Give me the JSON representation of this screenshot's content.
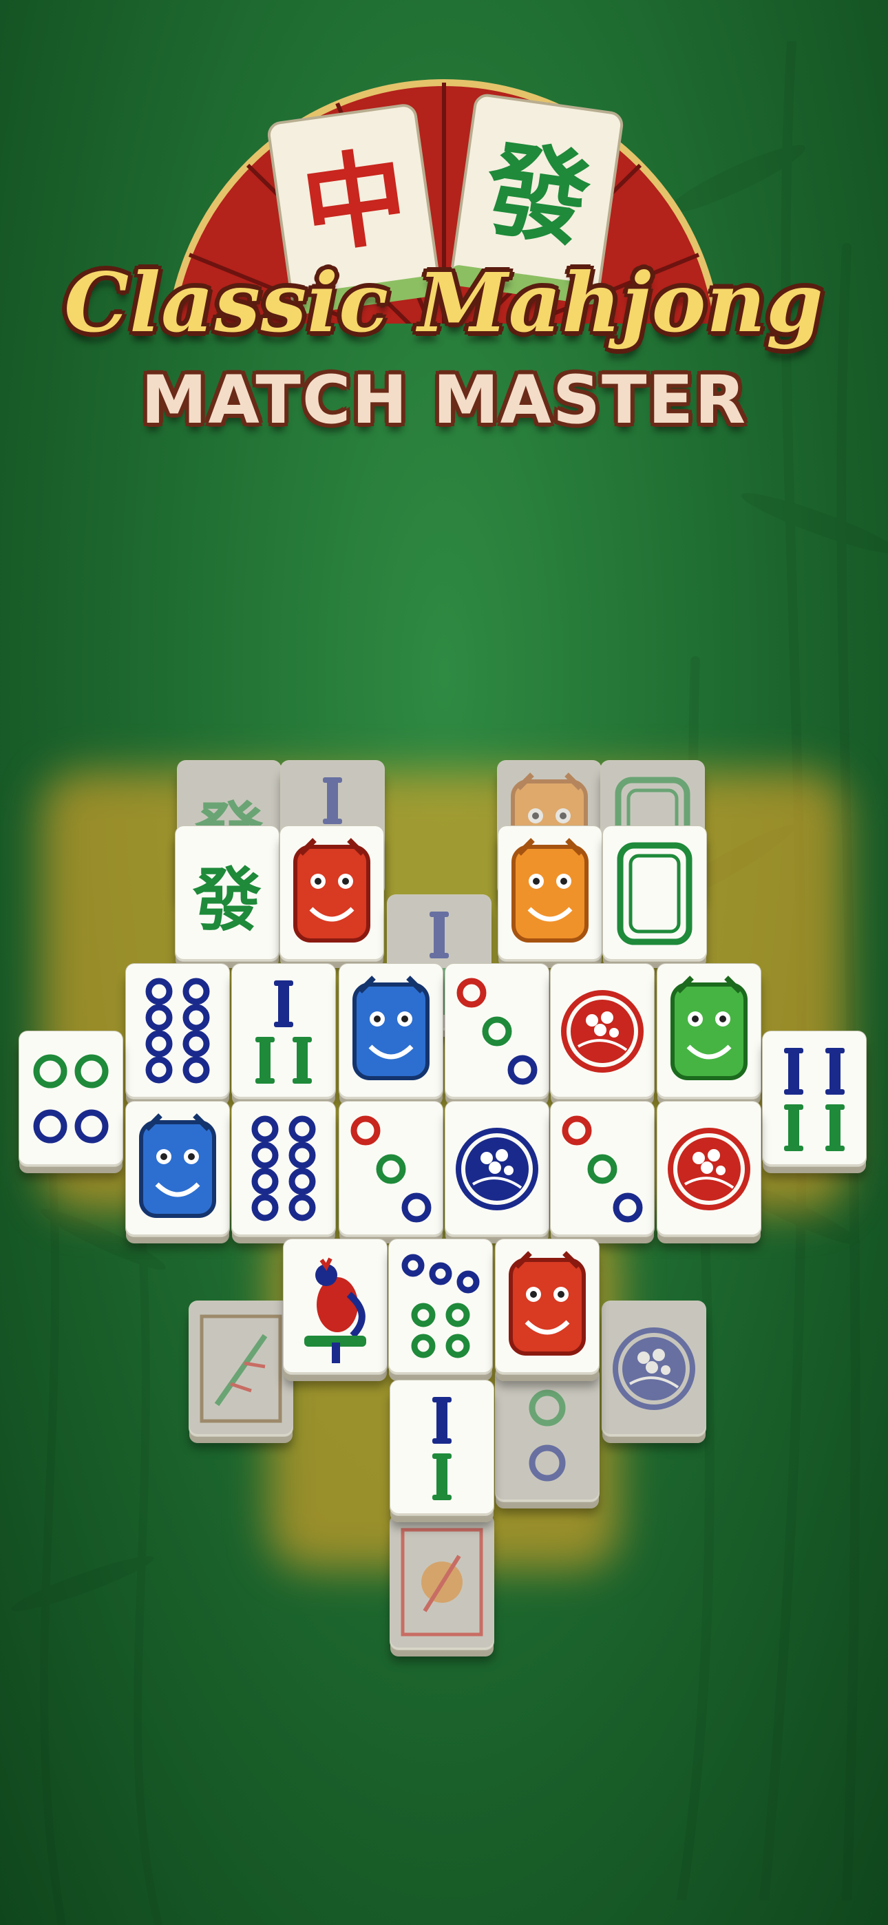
{
  "title": {
    "line1": "Classic Mahjong",
    "line2": "MATCH MASTER",
    "logo_tiles": [
      "中",
      "發"
    ]
  },
  "colors": {
    "background": "#1f6c31",
    "tile_face": "#fbfbf5",
    "mahjong_red": "#c8261e",
    "mahjong_green": "#1e8a3a",
    "mahjong_blue": "#1a2a8c",
    "glow": "#ffaf28",
    "title_gold": "#f6d76a"
  },
  "tiles": [
    {
      "id": "t01",
      "icon": "green-dragon-char-icon",
      "text": "發",
      "dim": true
    },
    {
      "id": "t02",
      "icon": "bamboo-three-icon",
      "dim": true
    },
    {
      "id": "t03",
      "icon": "dragon-orange-icon",
      "dim": true
    },
    {
      "id": "t04",
      "icon": "white-dragon-frame-icon",
      "dim": true
    },
    {
      "id": "t05",
      "icon": "green-dragon-char-icon",
      "text": "發"
    },
    {
      "id": "t06",
      "icon": "dragon-red-icon"
    },
    {
      "id": "t07",
      "icon": "dragon-orange-icon"
    },
    {
      "id": "t08",
      "icon": "white-dragon-frame-icon"
    },
    {
      "id": "t09",
      "icon": "bamboo-two-icon",
      "dim": true
    },
    {
      "id": "t10",
      "icon": "circle-eight-icon"
    },
    {
      "id": "t11",
      "icon": "bamboo-three-icon"
    },
    {
      "id": "t12",
      "icon": "dragon-blue-icon"
    },
    {
      "id": "t13",
      "icon": "circle-three-icon"
    },
    {
      "id": "t14",
      "icon": "flower-plum-red-icon"
    },
    {
      "id": "t15",
      "icon": "dragon-green-icon"
    },
    {
      "id": "t16",
      "icon": "circle-four-icon"
    },
    {
      "id": "t17",
      "icon": "bamboo-four-icon"
    },
    {
      "id": "t18",
      "icon": "dragon-blue-icon"
    },
    {
      "id": "t19",
      "icon": "circle-eight-icon"
    },
    {
      "id": "t20",
      "icon": "circle-three-icon"
    },
    {
      "id": "t21",
      "icon": "flower-plum-blue-icon"
    },
    {
      "id": "t22",
      "icon": "circle-three-icon"
    },
    {
      "id": "t23",
      "icon": "flower-plum-red-icon"
    },
    {
      "id": "t24",
      "icon": "bird-one-bamboo-icon"
    },
    {
      "id": "t25",
      "icon": "circle-seven-icon"
    },
    {
      "id": "t26",
      "icon": "dragon-red-icon"
    },
    {
      "id": "t27",
      "icon": "bamboo-two-icon"
    },
    {
      "id": "t28",
      "icon": "bamboo-season-icon",
      "dim": true
    },
    {
      "id": "t29",
      "icon": "flower-plum-blue-icon",
      "dim": true
    },
    {
      "id": "t30",
      "icon": "circle-two-icon",
      "dim": true
    },
    {
      "id": "t31",
      "icon": "autumn-season-icon",
      "dim": true
    }
  ]
}
